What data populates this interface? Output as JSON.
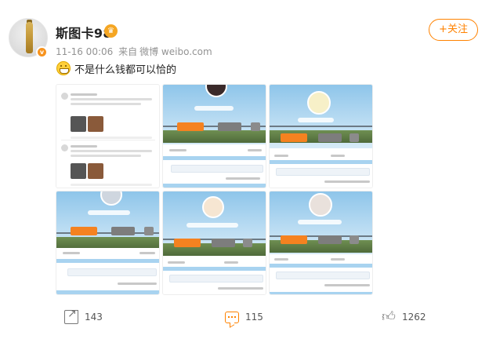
{
  "post": {
    "author": "斯图卡98",
    "verified_badge": "v",
    "crown_icon": "crown-icon",
    "time": "11-16 00:06",
    "source_prefix": "来自",
    "source": "微博 weibo.com",
    "follow_label": "+关注",
    "text": "不是什么钱都可以恰的",
    "emoji": "grin-icon"
  },
  "images": {
    "count": 6,
    "items": [
      {
        "kind": "feed-screenshot"
      },
      {
        "kind": "profile-screenshot"
      },
      {
        "kind": "profile-screenshot"
      },
      {
        "kind": "profile-screenshot"
      },
      {
        "kind": "profile-screenshot"
      },
      {
        "kind": "profile-screenshot"
      }
    ]
  },
  "actions": {
    "share_count": "143",
    "comment_count": "115",
    "like_count": "1262"
  },
  "colors": {
    "accent": "#ff8200",
    "username": "#222222",
    "meta": "#939393"
  }
}
